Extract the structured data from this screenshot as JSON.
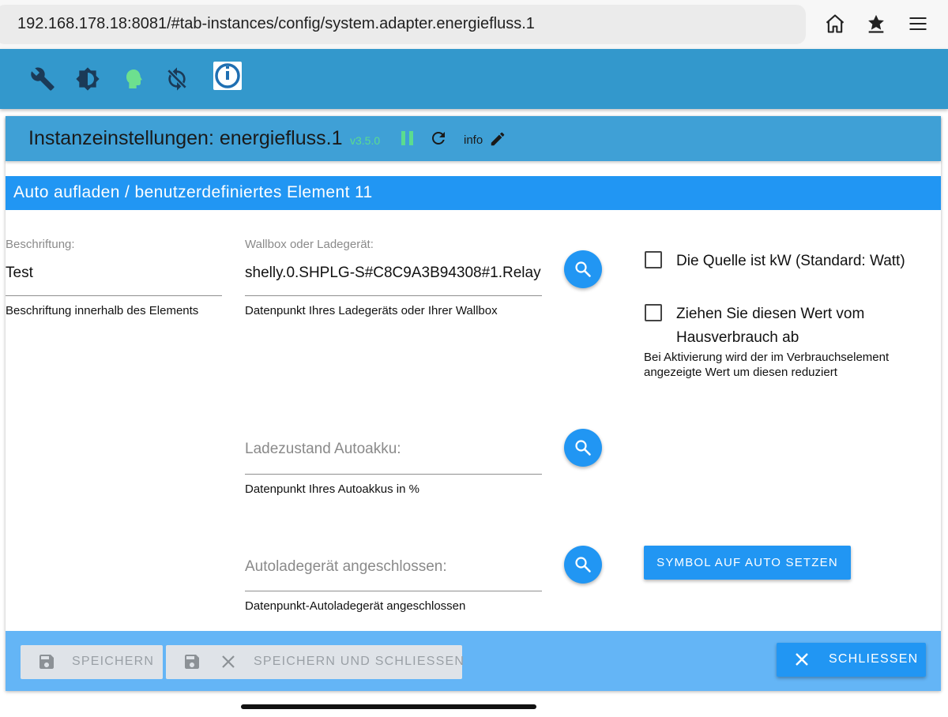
{
  "browser": {
    "url": "192.168.178.18:8081/#tab-instances/config/system.adapter.energiefluss.1",
    "icons": [
      "home-icon",
      "bookmark-star-icon",
      "menu-icon"
    ]
  },
  "toolbar": {
    "icons": [
      "wrench-icon",
      "brightness-icon",
      "expert-head-icon",
      "sync-off-icon",
      "iobroker-logo"
    ]
  },
  "dialog": {
    "title": "Instanzeinstellungen: energiefluss.1",
    "version": "v3.5.0",
    "info_label": "info",
    "section_title": "Auto aufladen / benutzerdefiniertes Element 11"
  },
  "form": {
    "label_field": {
      "label": "Beschriftung:",
      "value": "Test",
      "helper": "Beschriftung innerhalb des Elements"
    },
    "wallbox_field": {
      "label": "Wallbox oder Ladegerät:",
      "value": "shelly.0.SHPLG-S#C8C9A3B94308#1.Relay",
      "helper": "Datenpunkt Ihres Ladegeräts oder Ihrer Wallbox"
    },
    "soc_field": {
      "placeholder": "Ladezustand Autoakku:",
      "helper": "Datenpunkt Ihres Autoakkus in %"
    },
    "plugged_field": {
      "placeholder": "Autoladegerät angeschlossen:",
      "helper": "Datenpunkt-Autoladegerät angeschlossen"
    },
    "checkbox_kw": {
      "label": "Die Quelle ist kW (Standard: Watt)",
      "checked": false
    },
    "checkbox_subtract": {
      "label": "Ziehen Sie diesen Wert vom Hausverbrauch ab",
      "helper": "Bei Aktivierung wird der im Verbrauchselement angezeigte Wert um diesen reduziert",
      "checked": false
    },
    "symbol_button": "SYMBOL AUF AUTO SETZEN"
  },
  "footer": {
    "save": "SPEICHERN",
    "save_close": "SPEICHERN UND SCHLIESSEN",
    "close": "SCHLIESSEN"
  },
  "colors": {
    "toolbar": "#3398cc",
    "section_header": "#2196f3",
    "footer": "#64b5f6",
    "version_text": "#5bdc8f"
  }
}
